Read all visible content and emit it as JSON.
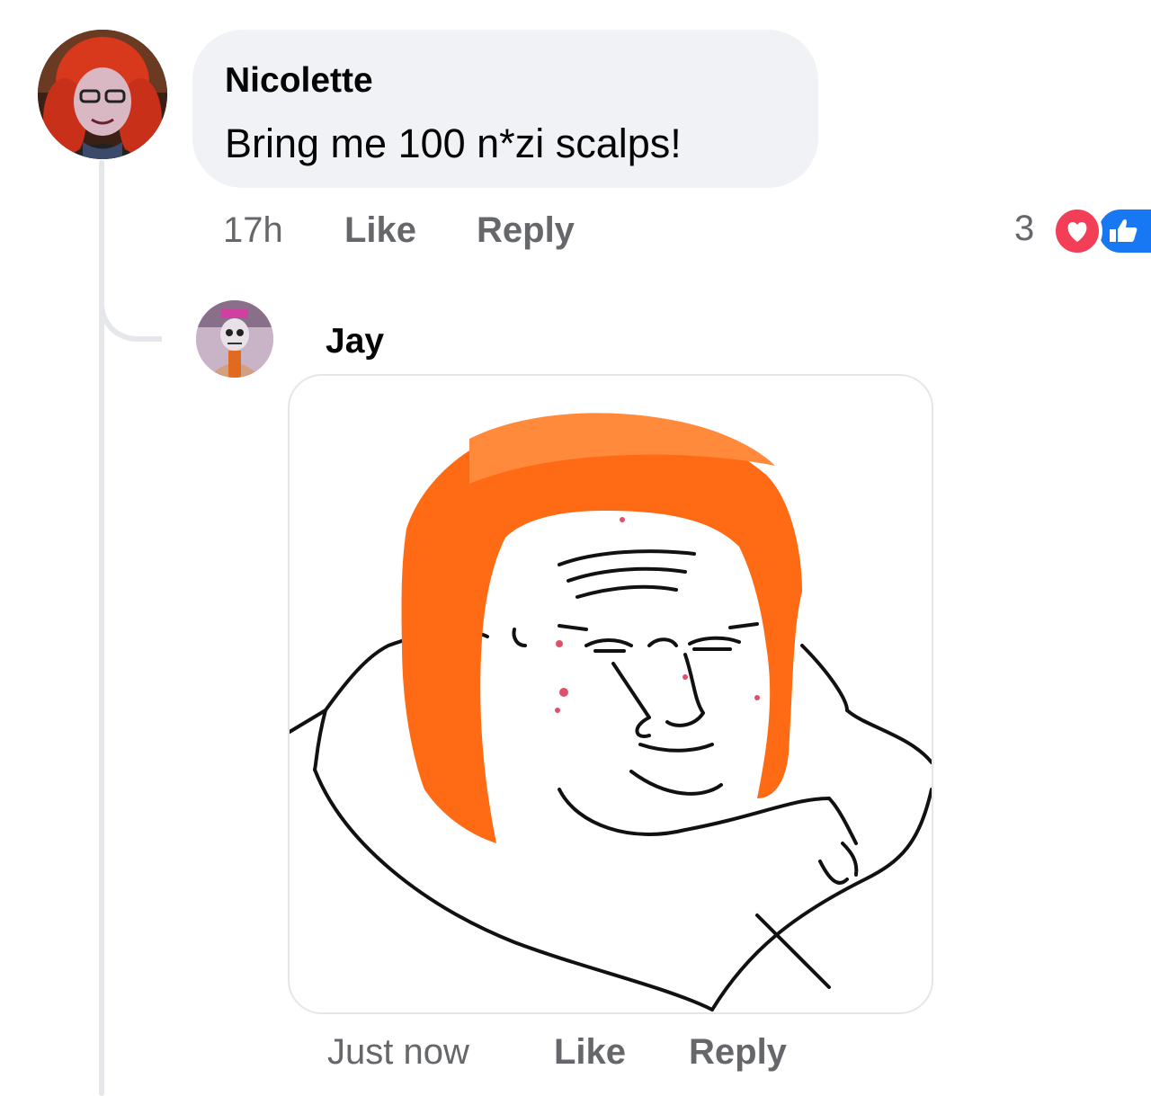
{
  "comments": [
    {
      "author": "Nicolette",
      "text": "Bring me 100 n*zi scalps!",
      "time": "17h",
      "like_label": "Like",
      "reply_label": "Reply",
      "reaction_count": "3",
      "reactions": [
        "heart-icon",
        "like-icon"
      ],
      "colors": {
        "heart": "#f33e58",
        "like": "#1877f2"
      }
    }
  ],
  "reply": {
    "author": "Jay",
    "time": "Just now",
    "like_label": "Like",
    "reply_label": "Reply",
    "sticker": "orange-haired-wojak-sticker",
    "colors": {
      "hair": "#ff6a14"
    }
  }
}
